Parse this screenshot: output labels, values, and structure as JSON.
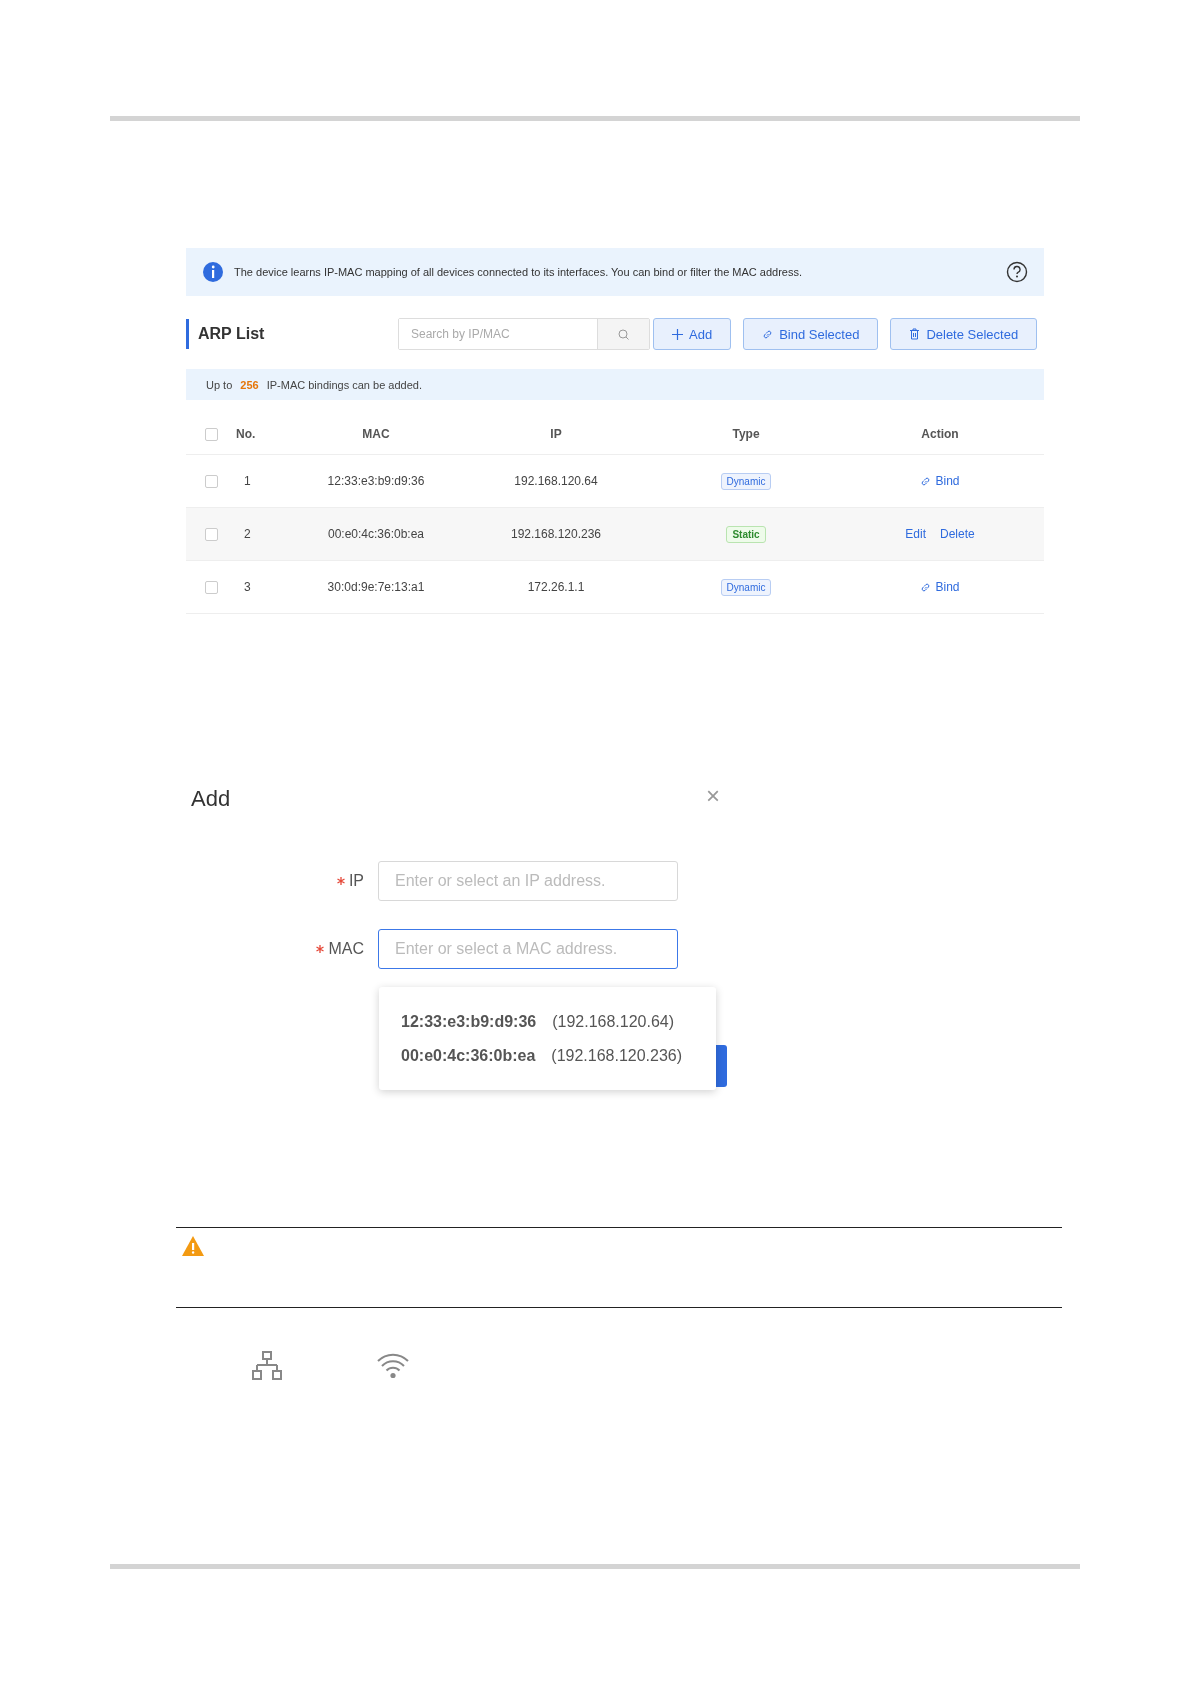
{
  "info_banner": {
    "text": "The device learns IP-MAC mapping of all devices connected to its interfaces. You can bind or filter the MAC address."
  },
  "arp_list": {
    "title": "ARP List",
    "search": {
      "placeholder": "Search by IP/MAC"
    },
    "buttons": [
      {
        "kind": "add",
        "label": "Add"
      },
      {
        "kind": "bind",
        "label": "Bind Selected"
      },
      {
        "kind": "delete",
        "label": "Delete Selected"
      }
    ],
    "limit_note": {
      "before": "Up to",
      "count": "256",
      "after": "IP-MAC bindings can be added."
    },
    "table": {
      "select_all_checked": false,
      "columns": [
        "No.",
        "MAC",
        "IP",
        "Type",
        "Action"
      ],
      "rows": [
        {
          "checked": false,
          "no": "1",
          "mac": "12:33:e3:b9:d9:36",
          "ip": "192.168.120.64",
          "type": {
            "kind": "dynamic",
            "label": "Dynamic"
          },
          "actions": [
            {
              "kind": "bind",
              "label": "Bind"
            }
          ]
        },
        {
          "checked": false,
          "no": "2",
          "mac": "00:e0:4c:36:0b:ea",
          "ip": "192.168.120.236",
          "type": {
            "kind": "static",
            "label": "Static"
          },
          "actions": [
            {
              "kind": "plain",
              "label": "Edit"
            },
            {
              "kind": "plain",
              "label": "Delete"
            }
          ]
        },
        {
          "checked": false,
          "no": "3",
          "mac": "30:0d:9e:7e:13:a1",
          "ip": "172.26.1.1",
          "type": {
            "kind": "dynamic",
            "label": "Dynamic"
          },
          "actions": [
            {
              "kind": "bind",
              "label": "Bind"
            }
          ]
        }
      ]
    }
  },
  "add_dialog": {
    "title": "Add",
    "close": "×",
    "fields": [
      {
        "label": "IP",
        "required": true,
        "placeholder": "Enter or select an IP address.",
        "focused": false
      },
      {
        "label": "MAC",
        "required": true,
        "placeholder": "Enter or select a MAC address.",
        "focused": true
      }
    ],
    "dropdown": [
      {
        "mac": "12:33:e3:b9:d9:36",
        "ip": "(192.168.120.64)"
      },
      {
        "mac": "00:e0:4c:36:0b:ea",
        "ip": "(192.168.120.236)"
      }
    ]
  }
}
